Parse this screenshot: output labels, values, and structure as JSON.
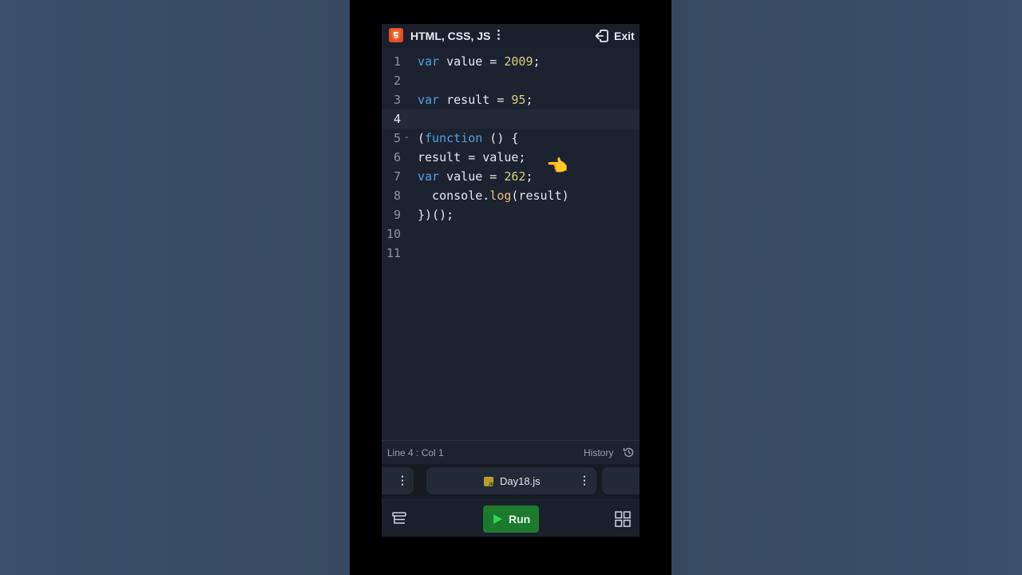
{
  "app": {
    "title": "HTML, CSS, JS",
    "menu_icon": "vertical-dots-icon",
    "exit_label": "Exit"
  },
  "editor": {
    "lines": [
      {
        "num": "1"
      },
      {
        "num": "2"
      },
      {
        "num": "3"
      },
      {
        "num": "4"
      },
      {
        "num": "5"
      },
      {
        "num": "6"
      },
      {
        "num": "7"
      },
      {
        "num": "8"
      },
      {
        "num": "9"
      },
      {
        "num": "10"
      },
      {
        "num": "11"
      }
    ],
    "tokens": {
      "l1_kw": "var",
      "l1_rest": " value = ",
      "l1_num": "2009",
      "l1_end": ";",
      "l3_kw": "var",
      "l3_rest": " result = ",
      "l3_num": "95",
      "l3_end": ";",
      "l5_open": "(",
      "l5_kw": "function",
      "l5_rest": " () {",
      "l6_text": "result = value;",
      "l7_kw": "var",
      "l7_rest": " value = ",
      "l7_num": "262",
      "l7_end": ";",
      "l8_pre": "  console.",
      "l8_fn": "log",
      "l8_post": "(result)",
      "l9_text": "})();"
    },
    "pointer_emoji": "👈"
  },
  "status": {
    "position": "Line 4 : Col 1",
    "history_label": "History"
  },
  "tabs": {
    "file_label": "Day18.js",
    "file_badge": "JS"
  },
  "bottom": {
    "run_label": "Run"
  }
}
